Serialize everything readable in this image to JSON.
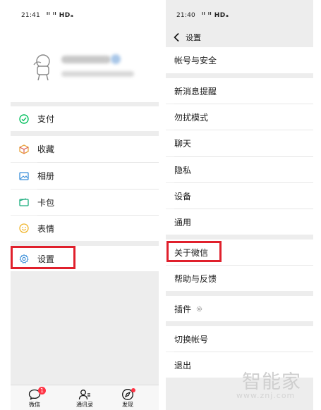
{
  "left": {
    "status_time": "21:41",
    "status_signal": "′ᴵ′ᴵ HDₐ",
    "menu": {
      "pay": "支付",
      "favorites": "收藏",
      "album": "相册",
      "cards": "卡包",
      "stickers": "表情",
      "settings": "设置"
    },
    "tabs": {
      "chats": "微信",
      "chats_badge": "1",
      "contacts": "通讯录",
      "discover": "发现"
    }
  },
  "right": {
    "status_time": "21:40",
    "status_signal": "′ᴵ′ᴵ HDₐ",
    "header_title": "设置",
    "items": {
      "account": "帐号与安全",
      "notifications": "新消息提醒",
      "do_not_disturb": "勿扰模式",
      "chat": "聊天",
      "privacy": "隐私",
      "devices": "设备",
      "general": "通用",
      "about": "关于微信",
      "help": "帮助与反馈",
      "plugins": "插件",
      "switch_account": "切换帐号",
      "logout": "退出"
    }
  },
  "watermark": {
    "brand": "智能家",
    "url": "www.znj.com"
  },
  "colors": {
    "highlight": "#e0202c",
    "accent_green": "#07c160",
    "settings_blue": "#3b8fd9"
  }
}
